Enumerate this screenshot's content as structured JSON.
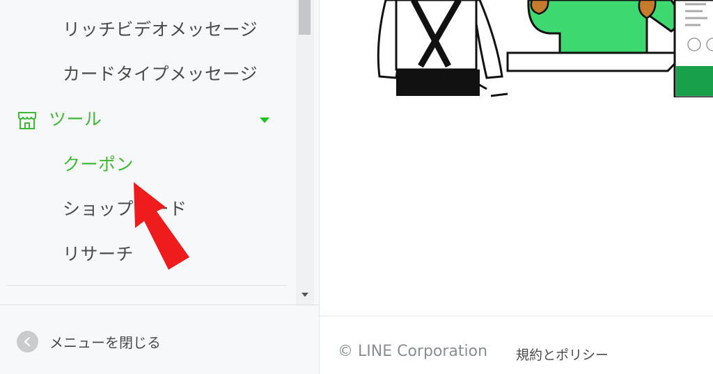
{
  "sidebar": {
    "items": [
      {
        "label": "リッチビデオメッセージ"
      },
      {
        "label": "カードタイプメッセージ"
      }
    ],
    "tools": {
      "label": "ツール",
      "icon": "store-icon",
      "subitems": [
        {
          "label": "クーポン",
          "active": true
        },
        {
          "label": "ショップカード"
        },
        {
          "label": "リサーチ"
        }
      ]
    },
    "close_menu": {
      "label": "メニューを閉じる",
      "icon": "chevron-left-icon"
    }
  },
  "footer": {
    "copyright": "© LINE Corporation",
    "policy_link": "規約とポリシー"
  },
  "colors": {
    "accent_green": "#3fb935",
    "annotation_arrow": "#ee1c1c"
  }
}
